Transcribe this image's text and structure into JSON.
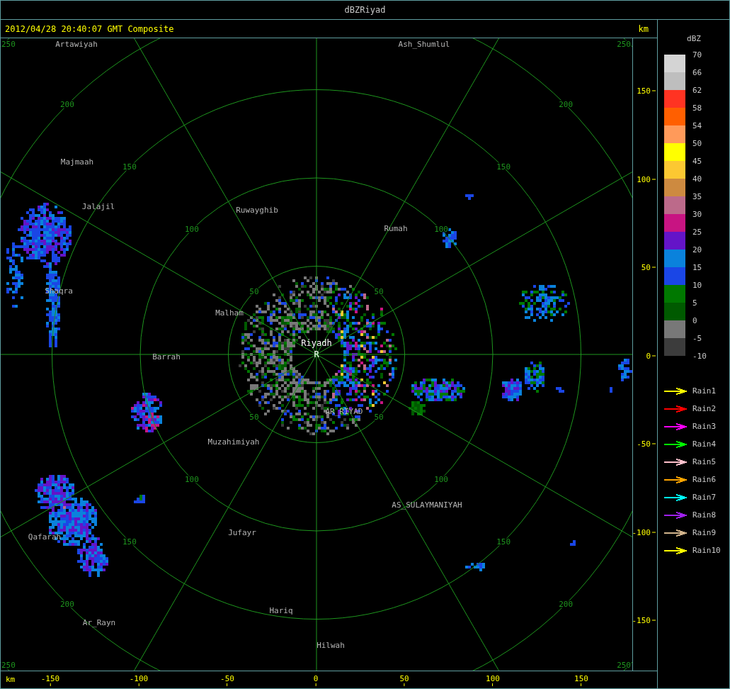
{
  "window": {
    "title": "dBZRiyad"
  },
  "header": {
    "timestamp": "2012/04/28 20:40:07 GMT Composite",
    "unit": "km"
  },
  "map": {
    "rings": [
      {
        "labels": [
          "50",
          "50",
          "50",
          "50"
        ]
      },
      {
        "labels": [
          "100",
          "100",
          "100",
          "100"
        ]
      },
      {
        "labels": [
          "150",
          "150",
          "150",
          "150"
        ]
      },
      {
        "labels": [
          "200",
          "200",
          "200",
          "200"
        ]
      },
      {
        "labels": [
          "250",
          "250",
          "250",
          "250"
        ]
      }
    ],
    "places": [
      {
        "name": "Artawiyah",
        "kind": "town"
      },
      {
        "name": "Ash_Shumlul",
        "kind": "town"
      },
      {
        "name": "Majmaah",
        "kind": "town"
      },
      {
        "name": "Jalajil",
        "kind": "town"
      },
      {
        "name": "Ruwayghib",
        "kind": "town"
      },
      {
        "name": "Rumah",
        "kind": "town"
      },
      {
        "name": "Shaqra",
        "kind": "town"
      },
      {
        "name": "Malham",
        "kind": "town"
      },
      {
        "name": "Riyadh",
        "kind": "site"
      },
      {
        "name": "R",
        "kind": "radar"
      },
      {
        "name": "Barrah",
        "kind": "town"
      },
      {
        "name": "AR_RIYAD",
        "kind": "town"
      },
      {
        "name": "Muzahimiyah",
        "kind": "town"
      },
      {
        "name": "AS_SULAYMANIYAH",
        "kind": "town"
      },
      {
        "name": "Qafarah",
        "kind": "town"
      },
      {
        "name": "Jufayr",
        "kind": "town"
      },
      {
        "name": "Hariq",
        "kind": "town"
      },
      {
        "name": "Ar_Rayn",
        "kind": "town"
      },
      {
        "name": "Hilwah",
        "kind": "town"
      }
    ]
  },
  "y_axis": {
    "ticks": [
      "150",
      "100",
      "50",
      "0",
      "-50",
      "-100",
      "-150"
    ]
  },
  "x_axis": {
    "unit": "km",
    "ticks": [
      "-150",
      "-100",
      "-50",
      "0",
      "50",
      "100",
      "150"
    ]
  },
  "legend": {
    "title": "dBZ",
    "bands": [
      {
        "color": "#d4d4d4"
      },
      {
        "color": "#bebebe"
      },
      {
        "color": "#ff3322"
      },
      {
        "color": "#ff5f00"
      },
      {
        "color": "#ff9a5a"
      },
      {
        "color": "#ffff00"
      },
      {
        "color": "#fcc832"
      },
      {
        "color": "#cd8a40"
      },
      {
        "color": "#bc6a8a"
      },
      {
        "color": "#c81482"
      },
      {
        "color": "#6414c8"
      },
      {
        "color": "#0a82dc"
      },
      {
        "color": "#1a46e6"
      },
      {
        "color": "#007800"
      },
      {
        "color": "#005a00"
      },
      {
        "color": "#787878"
      },
      {
        "color": "#3c3c3c"
      }
    ],
    "labels": [
      "70",
      "66",
      "62",
      "58",
      "54",
      "50",
      "45",
      "40",
      "35",
      "30",
      "25",
      "20",
      "15",
      "10",
      "5",
      "0",
      "-5",
      "-10"
    ],
    "tracks": [
      {
        "name": "Rain1",
        "color": "#ffff00"
      },
      {
        "name": "Rain2",
        "color": "#ff0000"
      },
      {
        "name": "Rain3",
        "color": "#ff00ff"
      },
      {
        "name": "Rain4",
        "color": "#00ff00"
      },
      {
        "name": "Rain5",
        "color": "#ffc0cb"
      },
      {
        "name": "Rain6",
        "color": "#ffa500"
      },
      {
        "name": "Rain7",
        "color": "#00ffff"
      },
      {
        "name": "Rain8",
        "color": "#a020f0"
      },
      {
        "name": "Rain9",
        "color": "#d2b48c"
      },
      {
        "name": "Rain10",
        "color": "#ffff00"
      }
    ]
  }
}
